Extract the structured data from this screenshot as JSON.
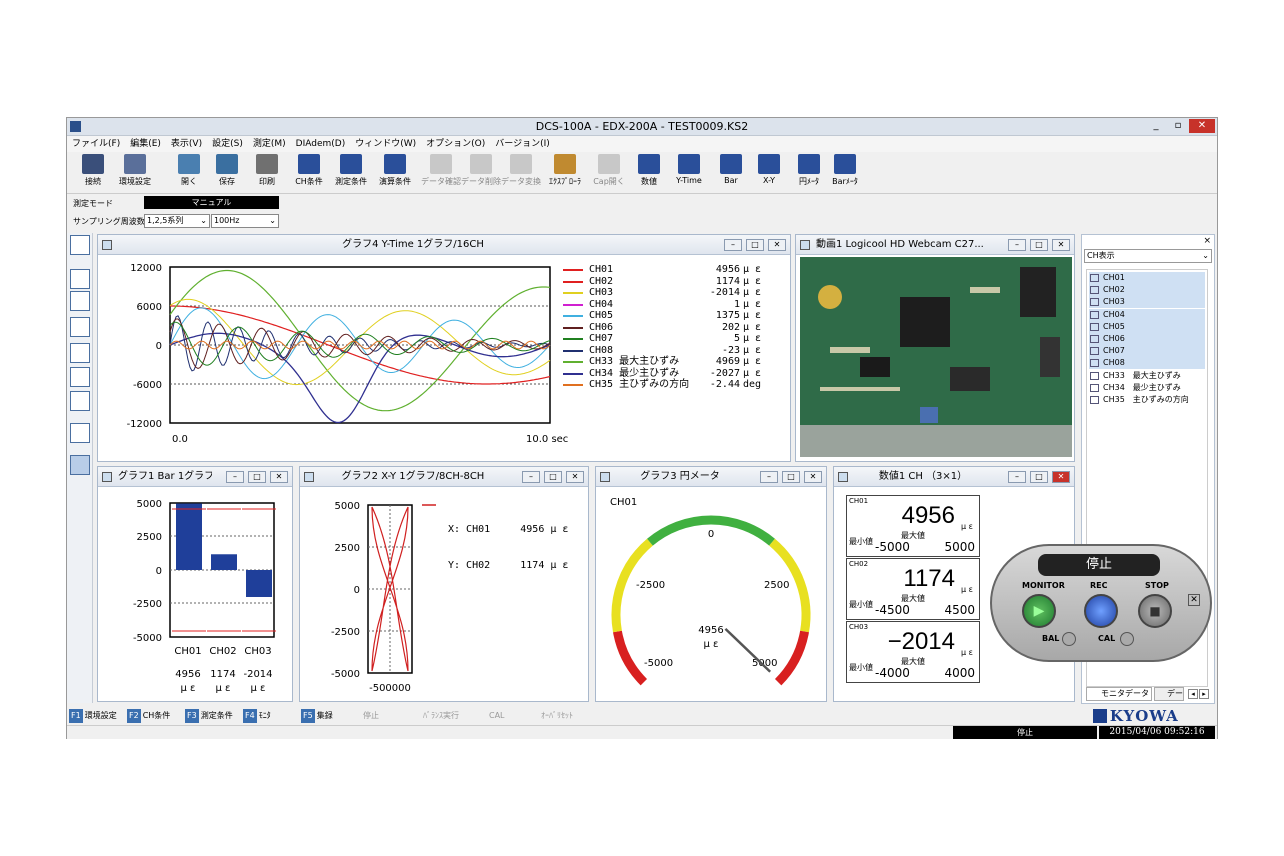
{
  "window": {
    "title": "DCS-100A - EDX-200A - TEST0009.KS2"
  },
  "menu": [
    "ファイル(F)",
    "編集(E)",
    "表示(V)",
    "設定(S)",
    "測定(M)",
    "DIAdem(D)",
    "ウィンドウ(W)",
    "オプション(O)",
    "バージョン(I)"
  ],
  "toolbar": [
    {
      "label": "接続",
      "icon": "connect-icon"
    },
    {
      "label": "環境設定",
      "icon": "environment-icon"
    },
    {
      "label": "開く",
      "icon": "open-icon"
    },
    {
      "label": "保存",
      "icon": "save-icon"
    },
    {
      "label": "印刷",
      "icon": "print-icon"
    },
    {
      "label": "CH条件",
      "icon": "ch-icon"
    },
    {
      "label": "測定条件",
      "icon": "mode-icon"
    },
    {
      "label": "演算条件",
      "icon": "calc-icon"
    },
    {
      "label": "データ確認",
      "icon": "data-check-icon"
    },
    {
      "label": "データ削除",
      "icon": "data-delete-icon"
    },
    {
      "label": "データ変換",
      "icon": "data-convert-icon"
    },
    {
      "label": "ｴｸｽﾌﾟﾛｰﾗ",
      "icon": "explorer-icon"
    },
    {
      "label": "Cap開く",
      "icon": "cap-open-icon"
    },
    {
      "label": "数値",
      "icon": "numeric-icon"
    },
    {
      "label": "Y-Time",
      "icon": "y-time-icon"
    },
    {
      "label": "Bar",
      "icon": "bar-icon"
    },
    {
      "label": "X-Y",
      "icon": "xy-icon"
    },
    {
      "label": "円ﾒｰﾀ",
      "icon": "circle-meter-icon"
    },
    {
      "label": "Barﾒｰﾀ",
      "icon": "bar-meter-icon"
    }
  ],
  "mode": {
    "label": "測定モード",
    "value": "マニュアル",
    "sampling_label": "サンプリング周波数",
    "series": "1,2,5系列",
    "freq": "100Hz"
  },
  "graph4": {
    "title": "グラフ4 Y-Time 1グラフ/16CH",
    "yticks": [
      "12000",
      "6000",
      "0",
      "-6000",
      "-12000"
    ],
    "xstart": "0.0",
    "xend": "10.0 sec",
    "legend": [
      {
        "name": "CH01",
        "value": "4956",
        "unit": "μ ε",
        "color": "#e02020"
      },
      {
        "name": "CH02",
        "value": "1174",
        "unit": "μ ε",
        "color": "#e02020"
      },
      {
        "name": "CH03",
        "value": "-2014",
        "unit": "μ ε",
        "color": "#e0d020"
      },
      {
        "name": "CH04",
        "value": "1",
        "unit": "μ ε",
        "color": "#d020d0"
      },
      {
        "name": "CH05",
        "value": "1375",
        "unit": "μ ε",
        "color": "#40b0e0"
      },
      {
        "name": "CH06",
        "value": "202",
        "unit": "μ ε",
        "color": "#602020"
      },
      {
        "name": "CH07",
        "value": "5",
        "unit": "μ ε",
        "color": "#208020"
      },
      {
        "name": "CH08",
        "value": "-23",
        "unit": "μ ε",
        "color": "#203070"
      },
      {
        "name": "CH33 最大主ひずみ",
        "value": "4969",
        "unit": "μ ε",
        "color": "#60b030"
      },
      {
        "name": "CH34 最少主ひずみ",
        "value": "-2027",
        "unit": "μ ε",
        "color": "#303090"
      },
      {
        "name": "CH35 主ひずみの方向",
        "value": "-2.44",
        "unit": "deg",
        "color": "#e07020"
      }
    ]
  },
  "video": {
    "title": "動画1 Logicool HD Webcam C27..."
  },
  "graph1": {
    "title": "グラフ1 Bar 1グラフ...",
    "yticks": [
      "5000",
      "2500",
      "0",
      "-2500",
      "-5000"
    ],
    "cats": [
      "CH01",
      "CH02",
      "CH03"
    ],
    "values": [
      "4956",
      "1174",
      "-2014"
    ],
    "unit": "μ ε"
  },
  "graph2": {
    "title": "グラフ2 X-Y 1グラフ/8CH-8CH",
    "yticks": [
      "5000",
      "2500",
      "0",
      "-2500",
      "-5000"
    ],
    "xticks": "-500000",
    "legend": [
      {
        "axis": "X: CH01",
        "value": "4956",
        "unit": "μ ε"
      },
      {
        "axis": "Y: CH02",
        "value": "1174",
        "unit": "μ ε"
      }
    ]
  },
  "graph3": {
    "title": "グラフ3 円メータ",
    "ch": "CH01",
    "ticks": [
      "0",
      "-2500",
      "2500",
      "-5000",
      "5000"
    ],
    "value": "4956",
    "unit": "μ ε"
  },
  "numeric": {
    "title": "数値1 CH （3×1）",
    "min_label": "最小値",
    "max_label": "最大値",
    "unit": "μ ε",
    "items": [
      {
        "ch": "CH01",
        "value": "4956",
        "min": "-5000",
        "max": "5000"
      },
      {
        "ch": "CH02",
        "value": "1174",
        "min": "-4500",
        "max": "4500"
      },
      {
        "ch": "CH03",
        "value": "−2014",
        "min": "-4000",
        "max": "4000"
      }
    ]
  },
  "rightpanel": {
    "dropdown": "CH表示",
    "items": [
      "CH01",
      "CH02",
      "CH03",
      "CH04",
      "CH05",
      "CH06",
      "CH07",
      "CH08",
      "CH33　最大主ひずみ",
      "CH34　最少主ひずみ",
      "CH35　主ひずみの方向"
    ],
    "tab1": "モニタデータ",
    "tab2": "デー"
  },
  "recorder": {
    "status": "停止",
    "monitor": "MONITOR",
    "rec": "REC",
    "stop": "STOP",
    "bal": "BAL",
    "cal": "CAL"
  },
  "fkeys": [
    {
      "key": "F1",
      "label": "環境設定",
      "enabled": true
    },
    {
      "key": "F2",
      "label": "CH条件",
      "enabled": true
    },
    {
      "key": "F3",
      "label": "測定条件",
      "enabled": true
    },
    {
      "key": "F4",
      "label": "ﾓﾆﾀ",
      "enabled": true
    },
    {
      "key": "F5",
      "label": "集録",
      "enabled": true
    },
    {
      "key": "",
      "label": "停止",
      "enabled": false
    },
    {
      "key": "",
      "label": "ﾊﾞﾗﾝｽ実行",
      "enabled": false
    },
    {
      "key": "",
      "label": "CAL",
      "enabled": false
    },
    {
      "key": "",
      "label": "ｵｰﾊﾞﾘｾｯﾄ",
      "enabled": false
    }
  ],
  "brand": "KYOWA",
  "statusbar": {
    "state": "停止",
    "datetime": "2015/04/06 09:52:16"
  }
}
